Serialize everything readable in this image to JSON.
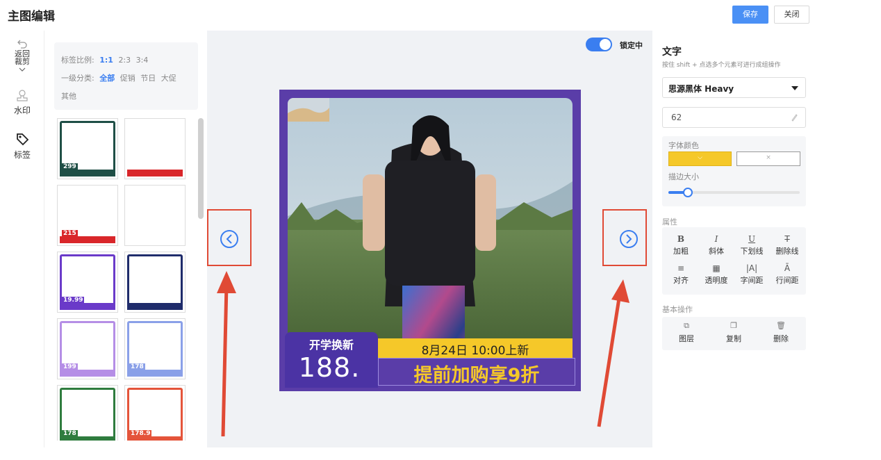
{
  "header": {
    "title": "主图编辑",
    "save_label": "保存",
    "close_label": "关闭"
  },
  "toolbar": {
    "back_label": "返回裁剪",
    "watermark_label": "水印",
    "tag_label": "标签"
  },
  "filters": {
    "ratio_label": "标签比例:",
    "ratios": [
      "1:1",
      "2:3",
      "3:4"
    ],
    "active_ratio": "1:1",
    "category_label": "一级分类:",
    "categories": [
      "全部",
      "促销",
      "节日",
      "大促"
    ],
    "active_category": "全部",
    "other_label": "其他"
  },
  "templates": [
    {
      "top": "#1f4f46",
      "bottom": "#1f4f46",
      "price": "299"
    },
    {
      "top": "#fff",
      "bottom": "#d9262a"
    },
    {
      "top": "#fff",
      "bottom": "#d9262a",
      "price": "215"
    },
    {
      "top": "#fff",
      "bottom": "#fff"
    },
    {
      "top": "#6a3ac9",
      "bottom": "#6a3ac9",
      "price": "19.99"
    },
    {
      "top": "#1f2c6b",
      "bottom": "#1f2c6b"
    },
    {
      "top": "#b58ee6",
      "bottom": "#b58ee6",
      "price": "199"
    },
    {
      "top": "#8aa0e8",
      "bottom": "#8aa0e8",
      "price": "178"
    },
    {
      "top": "#2f7c3e",
      "bottom": "#2f7c3e",
      "price": "178"
    },
    {
      "top": "#e4543a",
      "bottom": "#e4543a",
      "price": "178.9"
    }
  ],
  "canvas": {
    "lock_label": "锁定中",
    "poster": {
      "badge_title": "开学换新",
      "badge_price": "188.",
      "date_text": "8月24日 10:00上新",
      "promo_text": "提前加购享9折"
    }
  },
  "props": {
    "title": "文字",
    "hint": "按住 shift + 点选多个元素可进行成组操作",
    "font_name": "思源黑体 Heavy",
    "font_size": "62",
    "font_color_label": "字体颜色",
    "stroke_label": "描边大小",
    "stroke_value": 0.1,
    "font_color": "#f5c829",
    "attr_section": "属性",
    "attrs": [
      "加粗",
      "斜体",
      "下划线",
      "删除线",
      "对齐",
      "透明度",
      "字间距",
      "行间距"
    ],
    "basic_section": "基本操作",
    "basic_ops": [
      "图层",
      "复制",
      "删除"
    ]
  },
  "colors": {
    "accent": "#3a7ef0",
    "annotation": "#e04a35",
    "poster_purple": "#5a3da8",
    "poster_yellow": "#f5c829"
  }
}
